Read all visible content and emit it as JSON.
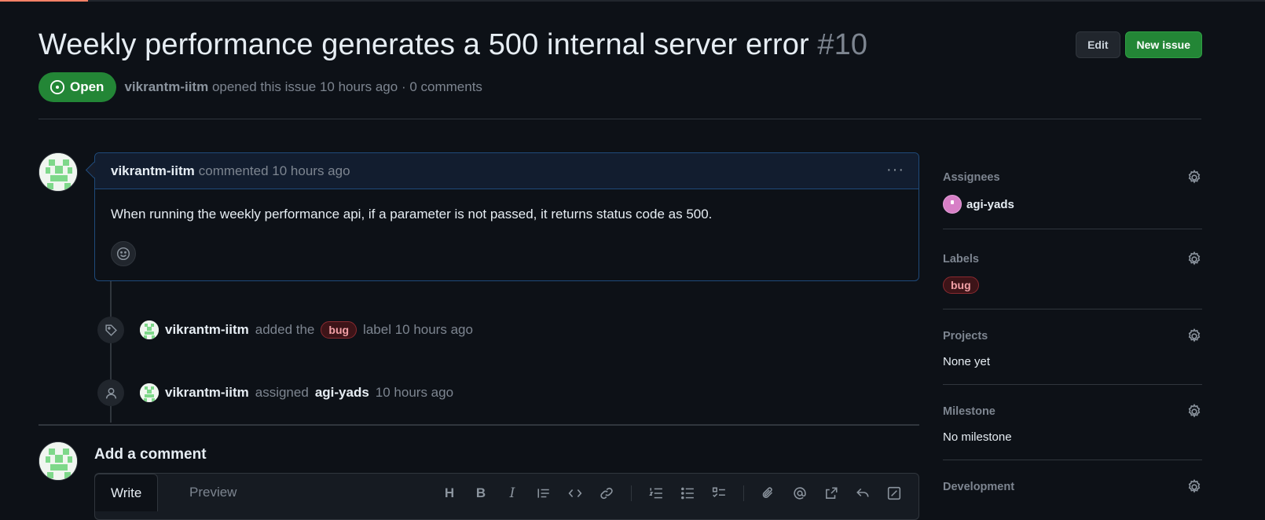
{
  "issue": {
    "title": "Weekly performance generates a 500 internal server error",
    "number": "#10",
    "state": "Open",
    "author": "vikrantm-iitm",
    "opened_text": "opened this issue 10 hours ago · 0 comments"
  },
  "header_actions": {
    "edit_label": "Edit",
    "new_issue_label": "New issue"
  },
  "comment": {
    "author": "vikrantm-iitm",
    "meta": "commented 10 hours ago",
    "more_label": "···",
    "body": "When running the weekly performance api, if a parameter is not passed, it returns status code as 500."
  },
  "timeline": [
    {
      "actor": "vikrantm-iitm",
      "text_before": "added the",
      "label": "bug",
      "text_after": "label 10 hours ago"
    },
    {
      "actor": "vikrantm-iitm",
      "text_before": "assigned",
      "target": "agi-yads",
      "text_after": "10 hours ago"
    }
  ],
  "add_comment": {
    "title": "Add a comment",
    "tabs": [
      "Write",
      "Preview"
    ],
    "toolbar": [
      "H",
      "B",
      "I"
    ]
  },
  "sidebar": {
    "assignees": {
      "heading": "Assignees",
      "value": "agi-yads"
    },
    "labels": {
      "heading": "Labels",
      "value": "bug"
    },
    "projects": {
      "heading": "Projects",
      "value": "None yet"
    },
    "milestone": {
      "heading": "Milestone",
      "value": "No milestone"
    },
    "development": {
      "heading": "Development"
    }
  },
  "colors": {
    "background": "#0d1117",
    "open_green": "#238636",
    "accent_blue": "#1f4a7a",
    "bug_label": "#f2a0a6"
  }
}
